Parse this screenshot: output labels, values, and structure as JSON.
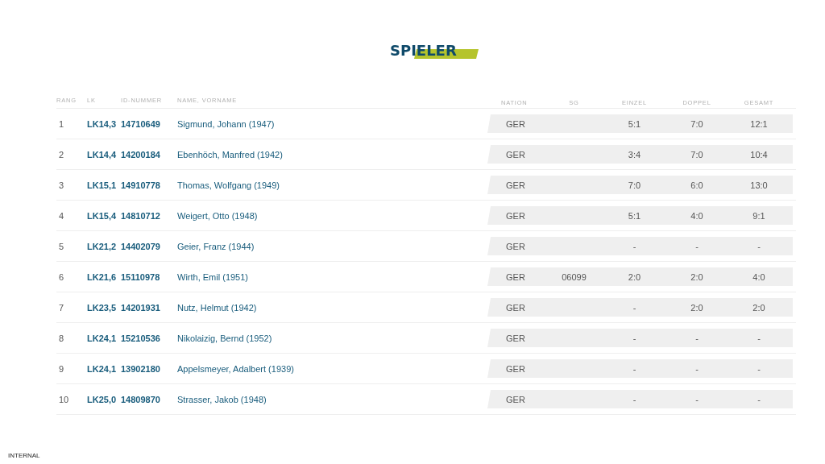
{
  "title": "SPIELER",
  "columns": [
    "RANG",
    "LK",
    "ID-NUMMER",
    "NAME, VORNAME",
    "NATION",
    "SG",
    "EINZEL",
    "DOPPEL",
    "GESAMT"
  ],
  "rows": [
    {
      "rang": "1",
      "lk": "LK14,3",
      "id": "14710649",
      "name": "Sigmund, Johann (1947)",
      "nation": "GER",
      "einzel": "5:1",
      "doppel": "7:0",
      "gesamt": "12:1"
    },
    {
      "rang": "2",
      "lk": "LK14,4",
      "id": "14200184",
      "name": "Ebenhöch, Manfred (1942)",
      "nation": "GER",
      "einzel": "3:4",
      "doppel": "7:0",
      "gesamt": "10:4"
    },
    {
      "rang": "3",
      "lk": "LK15,1",
      "id": "14910778",
      "name": "Thomas, Wolfgang (1949)",
      "nation": "GER",
      "einzel": "7:0",
      "doppel": "6:0",
      "gesamt": "13:0"
    },
    {
      "rang": "4",
      "lk": "LK15,4",
      "id": "14810712",
      "name": "Weigert, Otto (1948)",
      "nation": "GER",
      "einzel": "5:1",
      "doppel": "4:0",
      "gesamt": "9:1"
    },
    {
      "rang": "5",
      "lk": "LK21,2",
      "id": "14402079",
      "name": "Geier, Franz (1944)",
      "nation": "GER",
      "einzel": "-",
      "doppel": "-",
      "gesamt": "-"
    },
    {
      "rang": "6",
      "lk": "LK21,6",
      "id": "15110978",
      "name": "Wirth, Emil (1951)",
      "nation": "GER",
      "sg": "06099",
      "einzel": "2:0",
      "doppel": "2:0",
      "gesamt": "4:0"
    },
    {
      "rang": "7",
      "lk": "LK23,5",
      "id": "14201931",
      "name": "Nutz, Helmut (1942)",
      "nation": "GER",
      "einzel": "-",
      "doppel": "2:0",
      "gesamt": "2:0"
    },
    {
      "rang": "8",
      "lk": "LK24,1",
      "id": "15210536",
      "name": "Nikolaizig, Bernd (1952)",
      "nation": "GER",
      "einzel": "-",
      "doppel": "-",
      "gesamt": "-"
    },
    {
      "rang": "9",
      "lk": "LK24,1",
      "id": "13902180",
      "name": "Appelsmeyer, Adalbert (1939)",
      "nation": "GER",
      "einzel": "-",
      "doppel": "-",
      "gesamt": "-"
    },
    {
      "rang": "10",
      "lk": "LK25,0",
      "id": "14809870",
      "name": "Strasser, Jakob (1948)",
      "nation": "GER",
      "einzel": "-",
      "doppel": "-",
      "gesamt": "-"
    }
  ],
  "footer": "INTERNAL"
}
